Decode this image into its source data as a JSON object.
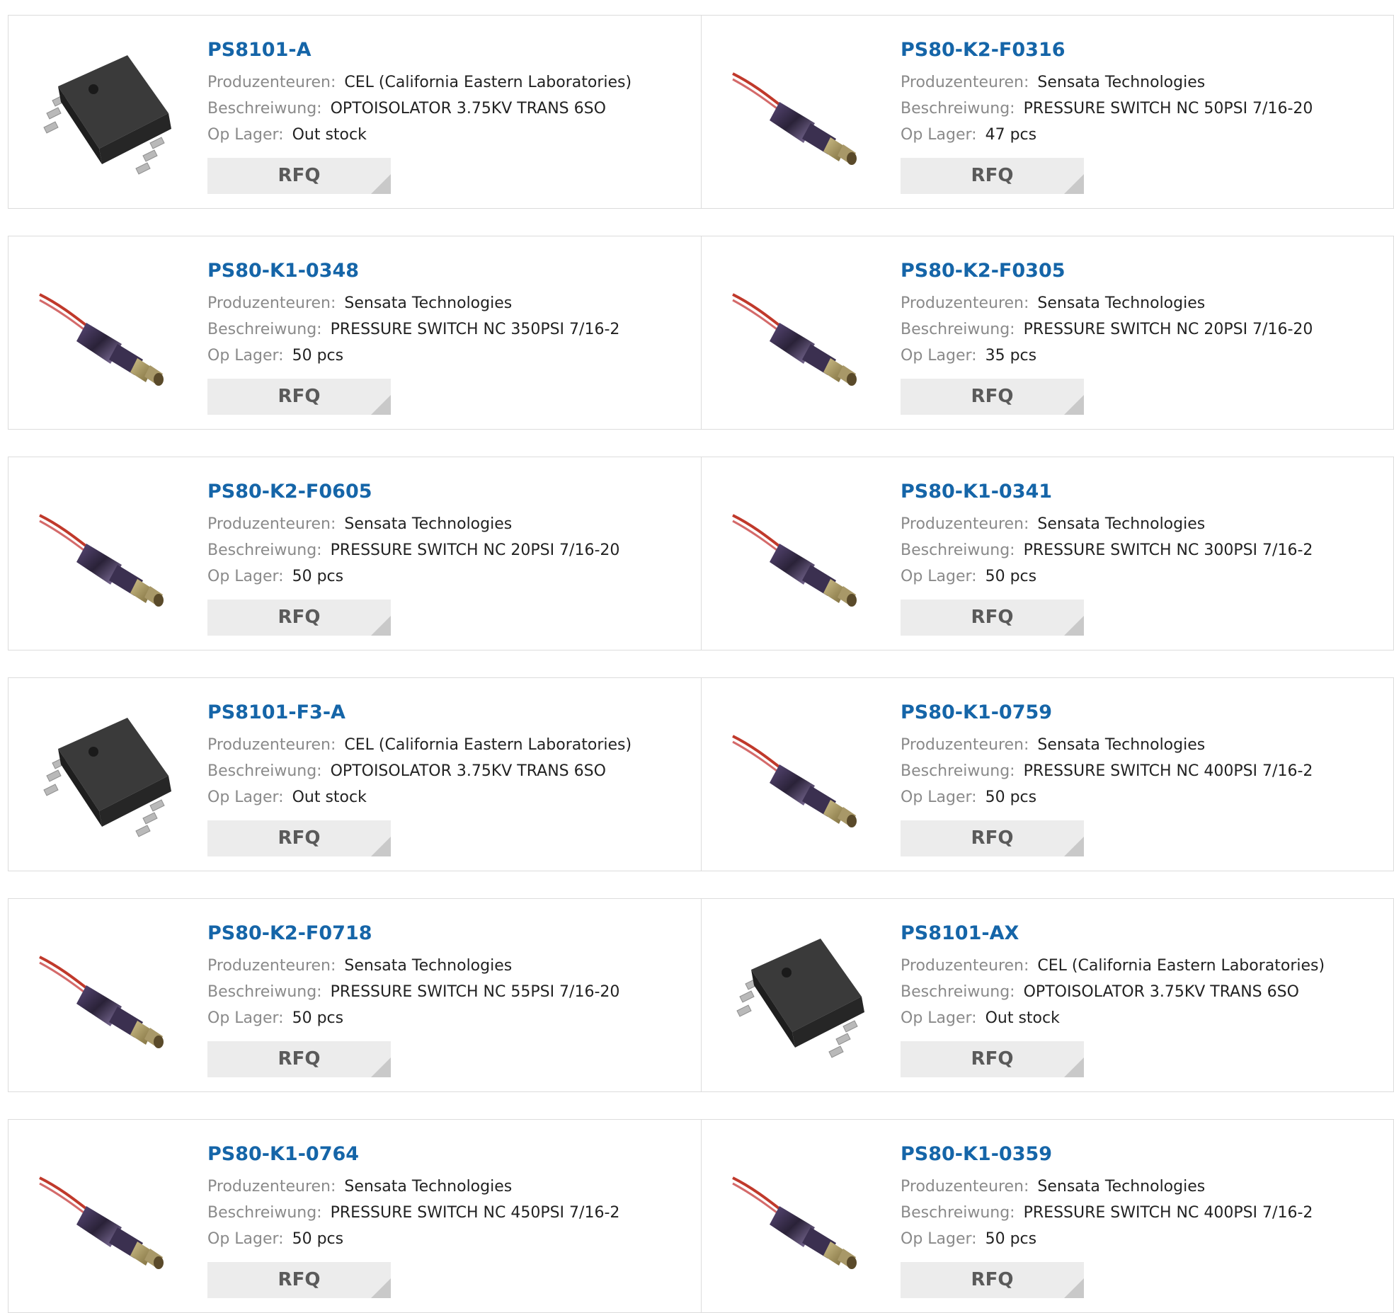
{
  "labels": {
    "manufacturer": "Produzenteuren:",
    "description": "Beschreiwung:",
    "stock": "Op Lager:",
    "rfq": "RFQ"
  },
  "products": [
    {
      "pn": "PS8101-A",
      "manufacturer": "CEL (California Eastern Laboratories)",
      "description": "OPTOISOLATOR 3.75KV TRANS 6SO",
      "stock": "Out stock",
      "image": "optoisolator-chip-icon"
    },
    {
      "pn": "PS80-K2-F0316",
      "manufacturer": "Sensata Technologies",
      "description": "PRESSURE SWITCH NC 50PSI 7/16-20",
      "stock": "47 pcs",
      "image": "pressure-switch-icon"
    },
    {
      "pn": "PS80-K1-0348",
      "manufacturer": "Sensata Technologies",
      "description": "PRESSURE SWITCH NC 350PSI 7/16-2",
      "stock": "50 pcs",
      "image": "pressure-switch-icon"
    },
    {
      "pn": "PS80-K2-F0305",
      "manufacturer": "Sensata Technologies",
      "description": "PRESSURE SWITCH NC 20PSI 7/16-20",
      "stock": "35 pcs",
      "image": "pressure-switch-icon"
    },
    {
      "pn": "PS80-K2-F0605",
      "manufacturer": "Sensata Technologies",
      "description": "PRESSURE SWITCH NC 20PSI 7/16-20",
      "stock": "50 pcs",
      "image": "pressure-switch-icon"
    },
    {
      "pn": "PS80-K1-0341",
      "manufacturer": "Sensata Technologies",
      "description": "PRESSURE SWITCH NC 300PSI 7/16-2",
      "stock": "50 pcs",
      "image": "pressure-switch-icon"
    },
    {
      "pn": "PS8101-F3-A",
      "manufacturer": "CEL (California Eastern Laboratories)",
      "description": "OPTOISOLATOR 3.75KV TRANS 6SO",
      "stock": "Out stock",
      "image": "optoisolator-chip-icon"
    },
    {
      "pn": "PS80-K1-0759",
      "manufacturer": "Sensata Technologies",
      "description": "PRESSURE SWITCH NC 400PSI 7/16-2",
      "stock": "50 pcs",
      "image": "pressure-switch-icon"
    },
    {
      "pn": "PS80-K2-F0718",
      "manufacturer": "Sensata Technologies",
      "description": "PRESSURE SWITCH NC 55PSI 7/16-20",
      "stock": "50 pcs",
      "image": "pressure-switch-icon"
    },
    {
      "pn": "PS8101-AX",
      "manufacturer": "CEL (California Eastern Laboratories)",
      "description": "OPTOISOLATOR 3.75KV TRANS 6SO",
      "stock": "Out stock",
      "image": "optoisolator-chip-icon"
    },
    {
      "pn": "PS80-K1-0764",
      "manufacturer": "Sensata Technologies",
      "description": "PRESSURE SWITCH NC 450PSI 7/16-2",
      "stock": "50 pcs",
      "image": "pressure-switch-icon"
    },
    {
      "pn": "PS80-K1-0359",
      "manufacturer": "Sensata Technologies",
      "description": "PRESSURE SWITCH NC 400PSI 7/16-2",
      "stock": "50 pcs",
      "image": "pressure-switch-icon"
    }
  ]
}
